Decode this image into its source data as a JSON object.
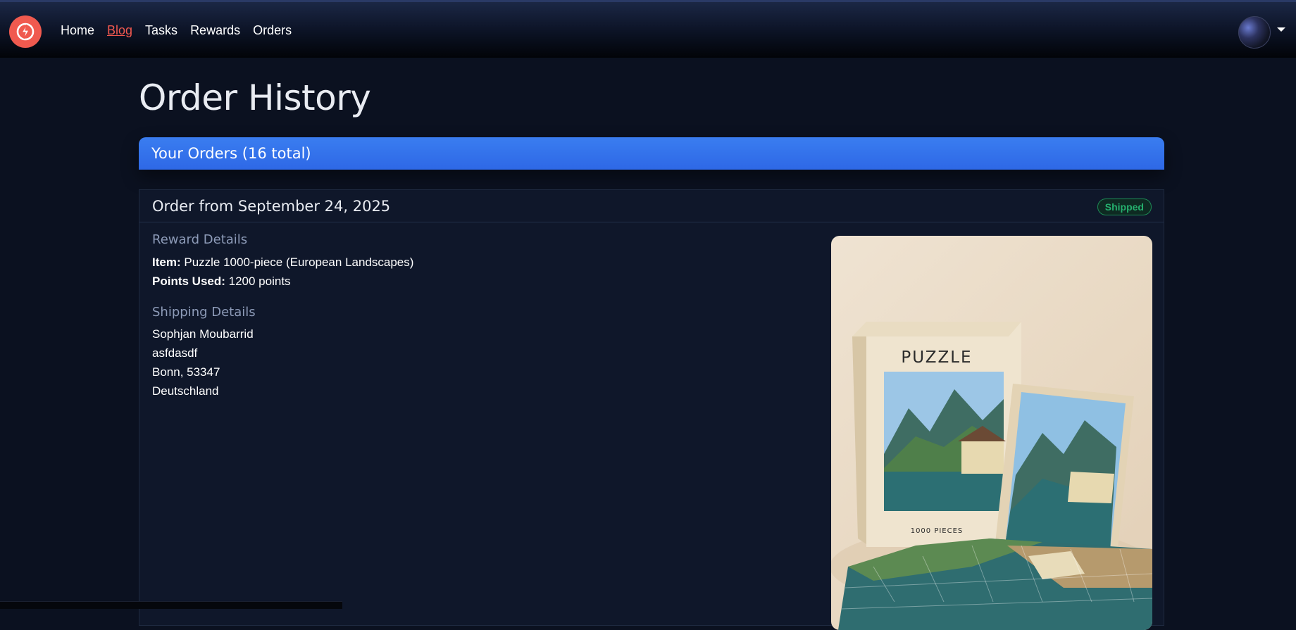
{
  "nav": {
    "logo_icon": "lightning-bolt-icon",
    "links": [
      {
        "label": "Home"
      },
      {
        "label": "Blog"
      },
      {
        "label": "Tasks"
      },
      {
        "label": "Rewards"
      },
      {
        "label": "Orders"
      }
    ],
    "active_link": "Blog",
    "accent_color": "#f0584f"
  },
  "page": {
    "title": "Order History"
  },
  "orders": {
    "header": "Your Orders (16 total)",
    "header_color": "#3173ea",
    "items": [
      {
        "title": "Order from September 24, 2025",
        "status": "Shipped",
        "status_color": "#25b06e",
        "reward_section_label": "Reward Details",
        "item_label": "Item:",
        "item_value": "Puzzle 1000-piece (European Landscapes)",
        "points_label": "Points Used:",
        "points_value": "1200 points",
        "shipping_section_label": "Shipping Details",
        "shipping_name": "Sophjan Moubarrid",
        "shipping_street": "asfdasdf",
        "shipping_city": "Bonn, 53347",
        "shipping_country": "Deutschland",
        "image": {
          "box_title": "PUZZLE",
          "box_subtitle": "1000 PIECES"
        }
      }
    ]
  }
}
